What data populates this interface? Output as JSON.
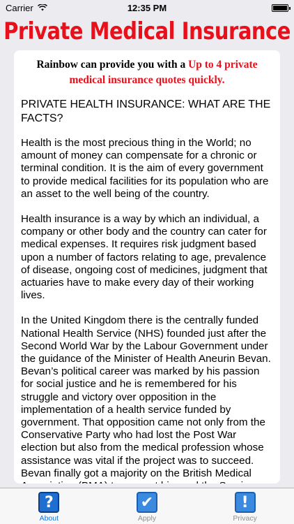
{
  "status": {
    "carrier": "Carrier",
    "time": "12:35 PM"
  },
  "app": {
    "title": "Private Medical Insurance"
  },
  "promo": {
    "intro": "Rainbow can provide you with a ",
    "highlight": "Up to 4 private medical insurance quotes quickly."
  },
  "article": {
    "heading": "PRIVATE HEALTH INSURANCE: WHAT ARE THE FACTS?",
    "paragraphs": [
      "Health is the most precious thing in the World; no amount of money can compensate for a chronic or terminal condition. It is the aim of every government to provide medical facilities for its population who are an asset to the well being of the country.",
      "Health insurance is a way by which an individual, a company or other body and the country can cater for medical expenses. It requires risk judgment based upon a number of factors relating to age, prevalence of disease, ongoing cost of medicines, judgment that actuaries have to make every day of their working lives.",
      "In the United Kingdom there is the centrally funded National Health Service (NHS) founded just after the Second World War by the Labour Government under the guidance of the Minister of Health Aneurin Bevan. Bevan’s political career was marked by his passion for social justice and he is remembered for his struggle and victory over opposition in the implementation of a health service funded by government. That opposition came not only from the Conservative Party who had lost the Post War election but also from the medical profession whose assistance was vital if the project was to succeed. Bevan finally got a majority on the British Medical Association (BMA) to support him and the Service came into being."
    ]
  },
  "tabs": [
    {
      "label": "About",
      "icon": "question-icon",
      "glyph": "?",
      "active": true,
      "color": "#1f6fd0"
    },
    {
      "label": "Apply",
      "icon": "checkmark-icon",
      "glyph": "✔",
      "active": false,
      "color": "#2f7fd6"
    },
    {
      "label": "Privacy",
      "icon": "exclamation-icon",
      "glyph": "!",
      "active": false,
      "color": "#2f7fd6"
    }
  ],
  "colors": {
    "accent_red": "#e8101a",
    "tab_active": "#1a73d9",
    "tab_inactive": "#8e8e93"
  }
}
